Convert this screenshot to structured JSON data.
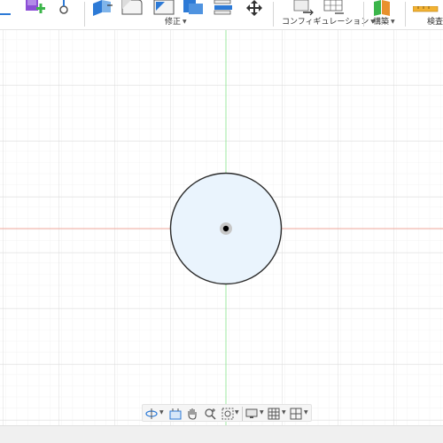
{
  "toolbar": {
    "groups": [
      {
        "label": "修正"
      },
      {
        "label": "コンフィギュレーション"
      },
      {
        "label": "構築"
      },
      {
        "label": "検査"
      }
    ]
  },
  "colors": {
    "accent_blue": "#2d7ad6",
    "add_green": "#3bb54a",
    "purple": "#8c4fd6",
    "x_axis": "#f0a89c",
    "y_axis": "#9ce8a0",
    "circle_fill": "#eaf4fd",
    "circle_stroke": "#2a2a2a"
  },
  "viewport": {
    "sketch": "circle",
    "center_point": "origin"
  },
  "navbar": {
    "icons": [
      "orbit-icon",
      "look-at-icon",
      "pan-icon",
      "zoom-icon",
      "fit-icon",
      "display-settings-icon",
      "grid-settings-icon",
      "viewports-icon"
    ]
  }
}
